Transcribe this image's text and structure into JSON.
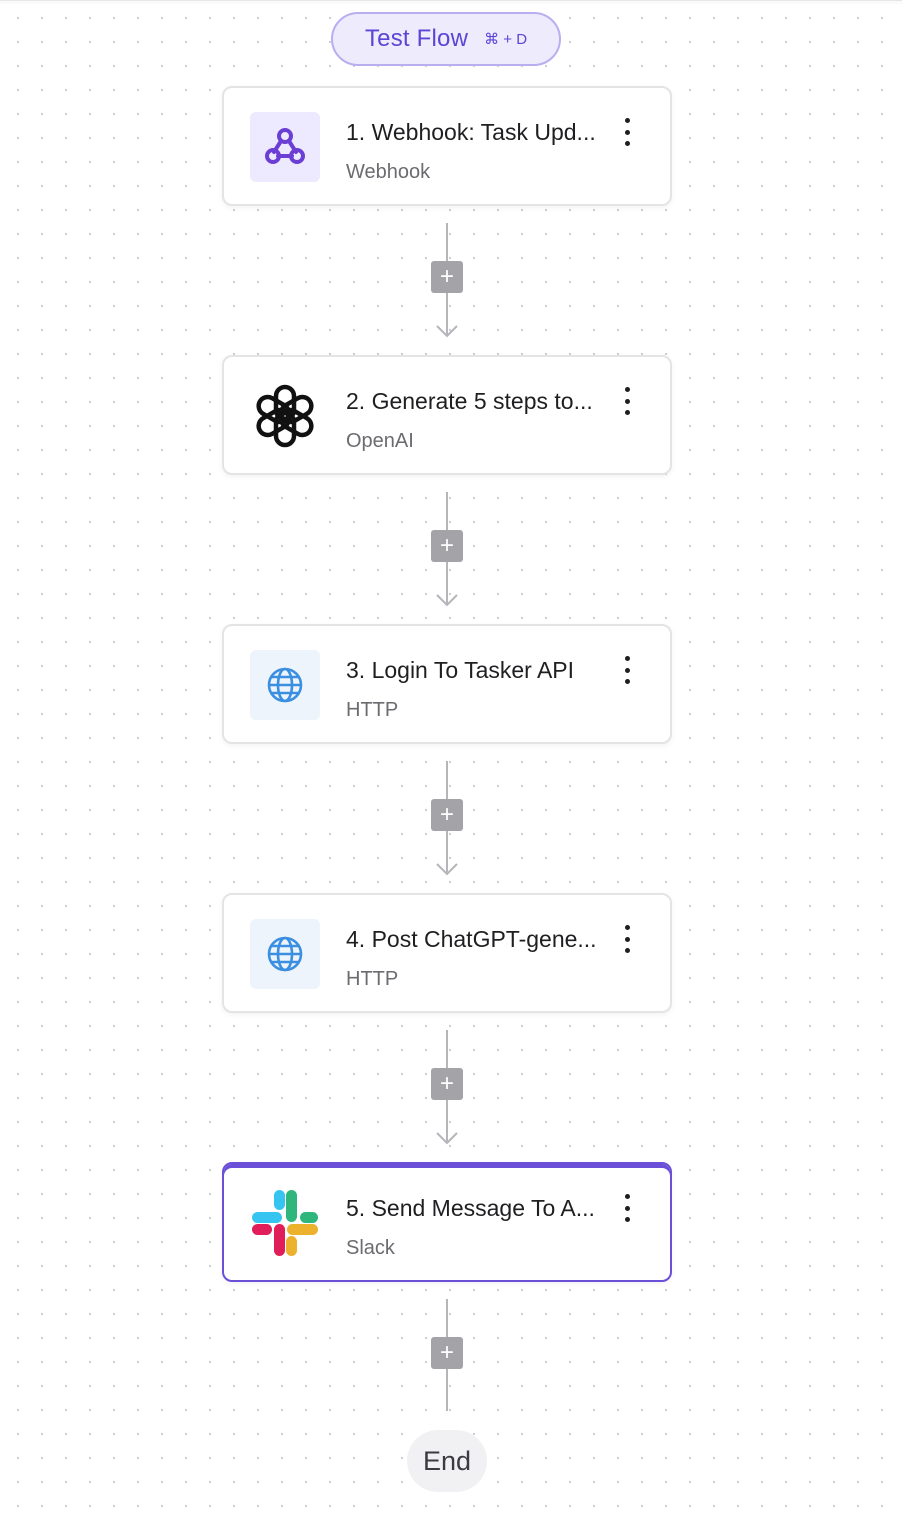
{
  "toolbar": {
    "test_flow_label": "Test Flow",
    "test_flow_shortcut": "⌘ + D"
  },
  "steps": [
    {
      "title": "1. Webhook: Task Upd...",
      "subtitle": "Webhook",
      "icon": "webhook-icon"
    },
    {
      "title": "2. Generate 5 steps to...",
      "subtitle": "OpenAI",
      "icon": "openai-icon"
    },
    {
      "title": "3. Login To Tasker API",
      "subtitle": "HTTP",
      "icon": "globe-icon"
    },
    {
      "title": "4. Post ChatGPT-gene...",
      "subtitle": "HTTP",
      "icon": "globe-icon"
    },
    {
      "title": "5. Send Message To A...",
      "subtitle": "Slack",
      "icon": "slack-icon",
      "selected": true
    }
  ],
  "add_step_symbol": "+",
  "end_label": "End",
  "colors": {
    "accent": "#6c4fd8",
    "test_flow_bg": "#eeebfd",
    "webhook_icon_bg": "#ede9fe",
    "http_icon_bg": "#eef4fb",
    "connector": "#b5b5ba",
    "plus_button": "#a3a3a8"
  }
}
